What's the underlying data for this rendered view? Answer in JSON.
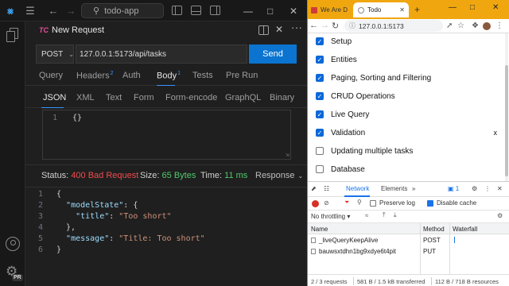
{
  "vscode": {
    "search": "todo-app",
    "request": {
      "tab_icon": "TC",
      "tab_title": "New Request",
      "method": "POST",
      "url": "127.0.0.1:5173/api/tasks",
      "send_label": "Send",
      "tabs": [
        {
          "label": "Query",
          "count": ""
        },
        {
          "label": "Headers",
          "count": "2"
        },
        {
          "label": "Auth",
          "count": ""
        },
        {
          "label": "Body",
          "count": "1"
        },
        {
          "label": "Tests",
          "count": ""
        },
        {
          "label": "Pre Run",
          "count": ""
        }
      ],
      "active_tab": "Body",
      "body_types": [
        "JSON",
        "XML",
        "Text",
        "Form",
        "Form-encode",
        "GraphQL",
        "Binary"
      ],
      "active_body_type": "JSON",
      "body_line_number": "1",
      "body_content": "{}"
    },
    "response": {
      "status_label": "Status:",
      "status_value": "400 Bad Request",
      "size_label": "Size:",
      "size_value": "65 Bytes",
      "time_label": "Time:",
      "time_value": "11 ms",
      "view_label": "Response",
      "lines": [
        {
          "n": "1",
          "text": "{"
        },
        {
          "n": "2",
          "text": "  \"modelState\": {"
        },
        {
          "n": "3",
          "text": "    \"title\": \"Too short\""
        },
        {
          "n": "4",
          "text": "  },"
        },
        {
          "n": "5",
          "text": "  \"message\": \"Title: Too short\""
        },
        {
          "n": "6",
          "text": "}"
        }
      ]
    },
    "badge": "PR"
  },
  "browser": {
    "tabs": [
      {
        "title": "We Are D"
      },
      {
        "title": "Todo"
      }
    ],
    "address": "127.0.0.1:5173",
    "todos": [
      {
        "title": "Setup",
        "completed": true
      },
      {
        "title": "Entities",
        "completed": true
      },
      {
        "title": "Paging, Sorting and Filtering",
        "completed": true
      },
      {
        "title": "CRUD Operations",
        "completed": true
      },
      {
        "title": "Live Query",
        "completed": true
      },
      {
        "title": "Validation",
        "completed": true
      },
      {
        "title": "Updating multiple tasks",
        "completed": false
      },
      {
        "title": "Database",
        "completed": false
      }
    ],
    "delete_glyph": "x",
    "devtools": {
      "tabs": {
        "network": "Network",
        "elements": "Elements"
      },
      "issues_count": "1",
      "preserve_log": "Preserve log",
      "disable_cache": "Disable cache",
      "throttling": "No throttling",
      "columns": {
        "name": "Name",
        "method": "Method",
        "waterfall": "Waterfall"
      },
      "rows": [
        {
          "name": "_liveQueryKeepAlive",
          "method": "POST"
        },
        {
          "name": "bauwsxtdhn1bg9xdye6t4pit",
          "method": "PUT"
        }
      ],
      "status": {
        "requests": "2 / 3 requests",
        "transferred": "581 B / 1.5 kB transferred",
        "resources": "112 B / 718 B resources"
      }
    }
  }
}
